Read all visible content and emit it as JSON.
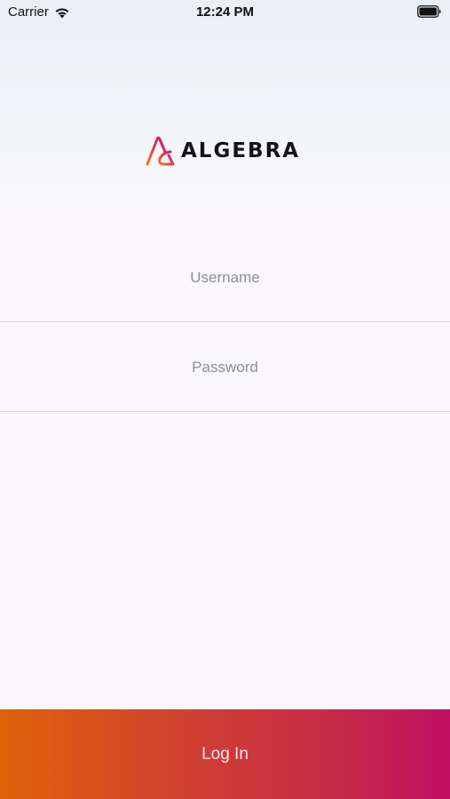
{
  "status_bar": {
    "carrier": "Carrier",
    "time": "12:24 PM",
    "wifi_icon": "wifi-icon",
    "battery_icon": "battery-icon"
  },
  "brand": {
    "name": "ALGEBRA",
    "logo_icon": "algebra-logo-icon",
    "colors": {
      "orange": "#e06208",
      "magenta": "#c20f64"
    }
  },
  "login_form": {
    "username_placeholder": "Username",
    "password_placeholder": "Password",
    "login_label": "Log In"
  }
}
